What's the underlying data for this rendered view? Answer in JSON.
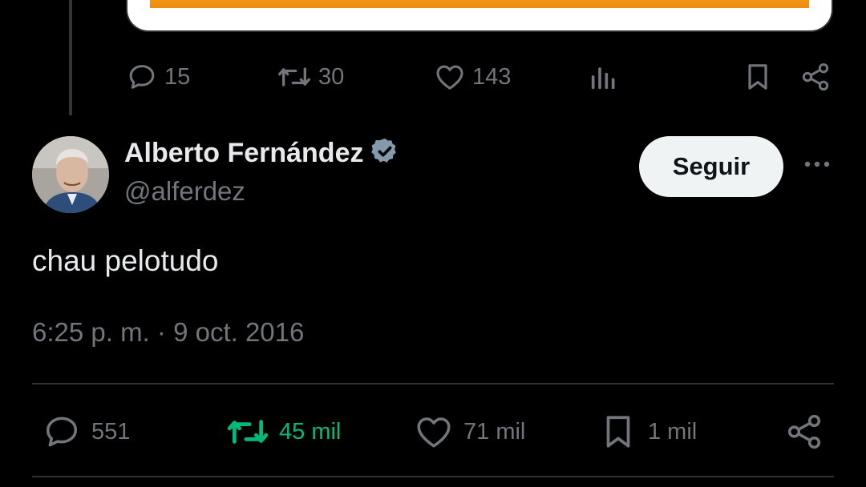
{
  "previous_post": {
    "replies": "15",
    "reposts": "30",
    "likes": "143",
    "icons": [
      "reply-icon",
      "repost-icon",
      "like-icon",
      "views-icon",
      "bookmark-icon",
      "share-icon"
    ],
    "media_accent_color": "#f39a15"
  },
  "post": {
    "author": {
      "display_name": "Alberto Fernández",
      "handle": "@alferdez",
      "verified": true
    },
    "follow_label": "Seguir",
    "text": "chau pelotudo",
    "timestamp": "6:25 p. m. · 9 oct. 2016",
    "stats": {
      "replies": "551",
      "reposts": "45 mil",
      "likes": "71 mil",
      "bookmarks": "1 mil"
    }
  },
  "colors": {
    "background": "#000000",
    "text_primary": "#e7e9ea",
    "text_secondary": "#71767b",
    "repost_active": "#00ba7c",
    "follow_button_bg": "#eff3f4",
    "divider": "#2f3336"
  }
}
